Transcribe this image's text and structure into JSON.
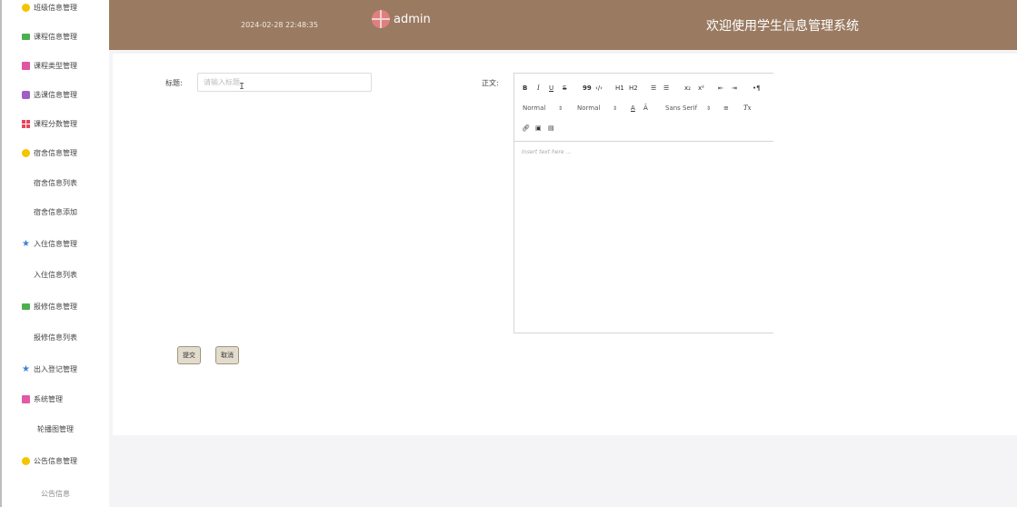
{
  "sidebar": {
    "items": [
      {
        "label": "班级信息管理",
        "icon": "circle-icon",
        "type": "parent"
      },
      {
        "label": "课程信息管理",
        "icon": "message-icon",
        "type": "parent"
      },
      {
        "label": "课程类型管理",
        "icon": "book-icon",
        "type": "parent"
      },
      {
        "label": "选课信息管理",
        "icon": "database-icon",
        "type": "parent"
      },
      {
        "label": "课程分数管理",
        "icon": "grid-icon",
        "type": "parent"
      },
      {
        "label": "宿舍信息管理",
        "icon": "circle-icon",
        "type": "parent"
      },
      {
        "label": "宿舍信息列表",
        "type": "child"
      },
      {
        "label": "宿舍信息添加",
        "type": "child"
      },
      {
        "label": "入住信息管理",
        "icon": "star-icon",
        "type": "parent"
      },
      {
        "label": "入住信息列表",
        "type": "child"
      },
      {
        "label": "报修信息管理",
        "icon": "message-icon",
        "type": "parent"
      },
      {
        "label": "报修信息列表",
        "type": "child"
      },
      {
        "label": "出入登记管理",
        "icon": "star-icon",
        "type": "parent"
      },
      {
        "label": "系统管理",
        "icon": "system-icon",
        "type": "parent"
      },
      {
        "label": "轮播图管理",
        "type": "child"
      },
      {
        "label": "公告信息管理",
        "icon": "circle-icon",
        "type": "parent"
      },
      {
        "label": "公告信息",
        "type": "child"
      }
    ]
  },
  "header": {
    "datetime": "2024-02-28 22:48:35",
    "username": "admin",
    "title": "欢迎使用学生信息管理系统"
  },
  "form": {
    "title_label": "标题:",
    "title_placeholder": "请输入标题",
    "title_value": "",
    "body_label": "正文:",
    "editor": {
      "bold": "B",
      "italic": "I",
      "underline": "U",
      "strike": "S",
      "blockquote": "99",
      "code": "‹/›",
      "h1": "H1",
      "h2": "H2",
      "ordered_list": "☰",
      "bullet_list": "☰",
      "subscript": "x₂",
      "superscript": "x²",
      "outdent": "⇤",
      "indent": "⇥",
      "direction": "•¶",
      "size_select": "Normal",
      "header_select": "Normal",
      "color": "A",
      "background": "Ā",
      "font_select": "Sans Serif",
      "align": "≡",
      "clean": "Tx",
      "placeholder": "Insert text here ..."
    },
    "submit_label": "提交",
    "cancel_label": "取消"
  },
  "colors": {
    "header_bg": "#9a7b62",
    "button_bg": "#e3dccd",
    "button_border": "#9c9582"
  }
}
